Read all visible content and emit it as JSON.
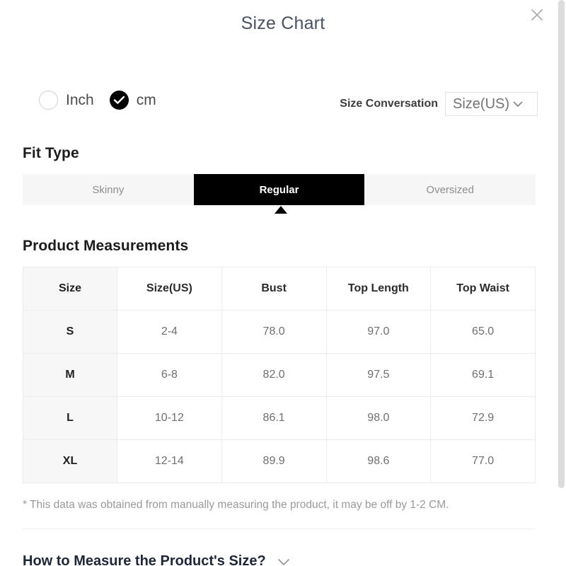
{
  "header": {
    "title": "Size Chart",
    "close_icon": "close-icon"
  },
  "units": {
    "options": [
      {
        "label": "Inch",
        "selected": false
      },
      {
        "label": "cm",
        "selected": true
      }
    ]
  },
  "size_conversion": {
    "label": "Size Conversation",
    "selected": "Size(US)",
    "chevron_icon": "chevron-down-icon"
  },
  "fit_type": {
    "heading": "Fit Type",
    "segments": [
      {
        "label": "Skinny",
        "active": false
      },
      {
        "label": "Regular",
        "active": true
      },
      {
        "label": "Oversized",
        "active": false
      }
    ]
  },
  "measurements": {
    "heading": "Product Measurements",
    "columns": [
      "Size",
      "Size(US)",
      "Bust",
      "Top Length",
      "Top Waist"
    ],
    "rows": [
      {
        "size": "S",
        "size_us": "2-4",
        "bust": "78.0",
        "top_length": "97.0",
        "top_waist": "65.0"
      },
      {
        "size": "M",
        "size_us": "6-8",
        "bust": "82.0",
        "top_length": "97.5",
        "top_waist": "69.1"
      },
      {
        "size": "L",
        "size_us": "10-12",
        "bust": "86.1",
        "top_length": "98.0",
        "top_waist": "72.9"
      },
      {
        "size": "XL",
        "size_us": "12-14",
        "bust": "89.9",
        "top_length": "98.6",
        "top_waist": "77.0"
      }
    ]
  },
  "footnote": "* This data was obtained from manually measuring the product, it may be off by 1-2 CM.",
  "how_to_measure": {
    "title": "How to Measure the Product's Size?",
    "chevron_icon": "chevron-down-icon"
  },
  "colors": {
    "accent": "#000000",
    "heading": "#1c1c1c",
    "muted_text": "#9a9a9a",
    "segment_bg": "#f6f6f6",
    "row_header_bg": "#f7f7f7",
    "border": "#ebebeb"
  }
}
